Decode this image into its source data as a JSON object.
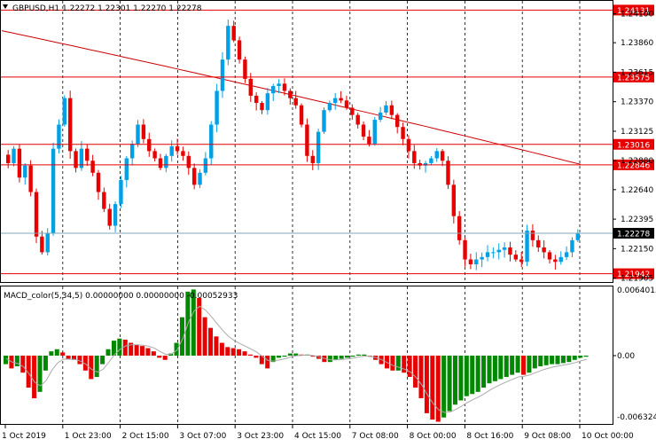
{
  "symbol_header": "GBPUSD,H1  1.22272 1.22301 1.22270 1.22278",
  "macd_header": "MACD_color(5,34,5) 0.00000000 0.00000000 -0.00052933",
  "colors": {
    "bull_candle": "#00a0e6",
    "bear_candle": "#e60000",
    "moving_average": "#cc0000",
    "level_line": "#e60000",
    "current_price_line": "#7fa7b8",
    "grid": "#000000",
    "macd_up": "#008800",
    "macd_down": "#e60000",
    "signal_line": "#aaaaaa",
    "price_label_bg": "#e60000",
    "current_label_bg": "#000000"
  },
  "chart_data": [
    {
      "type": "candlestick",
      "title": "GBPUSD,H1",
      "ylim": [
        1.2188,
        1.242
      ],
      "y_ticks": [
        "1.24100",
        "1.23860",
        "1.23615",
        "1.23370",
        "1.23125",
        "1.22880",
        "1.22640",
        "1.22395",
        "1.22150",
        "1.21905"
      ],
      "x_tick_labels": [
        "1 Oct 2019",
        "1 Oct 23:00",
        "2 Oct 15:00",
        "3 Oct 07:00",
        "3 Oct 23:00",
        "4 Oct 15:00",
        "7 Oct 08:00",
        "8 Oct 00:00",
        "8 Oct 16:00",
        "9 Oct 08:00",
        "10 Oct 00:00"
      ],
      "horizontal_levels": [
        "1.24131",
        "1.23575",
        "1.23016",
        "1.22846",
        "1.21942"
      ],
      "current_price": "1.22278",
      "ohlc_path": [
        1.2293,
        1.2286,
        1.2298,
        1.2274,
        1.2284,
        1.2262,
        1.2225,
        1.2212,
        1.2228,
        1.2298,
        1.2318,
        1.234,
        1.2296,
        1.2282,
        1.2298,
        1.2288,
        1.2278,
        1.2262,
        1.2248,
        1.2234,
        1.2252,
        1.2272,
        1.229,
        1.2302,
        1.2318,
        1.2306,
        1.2296,
        1.229,
        1.2282,
        1.2292,
        1.23,
        1.2296,
        1.2292,
        1.2282,
        1.2268,
        1.2278,
        1.229,
        1.2318,
        1.2346,
        1.2372,
        1.24,
        1.2388,
        1.2372,
        1.2356,
        1.2342,
        1.2336,
        1.233,
        1.2344,
        1.235,
        1.2352,
        1.2346,
        1.234,
        1.2334,
        1.2318,
        1.2292,
        1.2286,
        1.2312,
        1.233,
        1.2336,
        1.234,
        1.2338,
        1.2332,
        1.2326,
        1.2318,
        1.2308,
        1.2302,
        1.2322,
        1.2328,
        1.2334,
        1.2326,
        1.2316,
        1.2306,
        1.2296,
        1.2286,
        1.2284,
        1.2286,
        1.229,
        1.2296,
        1.2288,
        1.2268,
        1.2242,
        1.2222,
        1.2206,
        1.2202,
        1.2206,
        1.2208,
        1.2212,
        1.2212,
        1.2214,
        1.2216,
        1.221,
        1.2206,
        1.2204,
        1.223,
        1.2222,
        1.2216,
        1.2212,
        1.2206,
        1.2204,
        1.2208,
        1.2212,
        1.2222,
        1.2228
      ]
    },
    {
      "type": "bar",
      "title": "MACD_color(5,34,5)",
      "ylim": [
        -0.006324,
        0.006401
      ],
      "y_tick_labels": [
        "0.0064015",
        "0.00",
        "-0.006324"
      ],
      "histogram_values": [
        -0.0008,
        -0.0012,
        -0.001,
        -0.0016,
        -0.003,
        -0.004,
        -0.0034,
        -0.0014,
        0.0004,
        0.0006,
        0.0003,
        -0.0003,
        -0.0004,
        -0.0008,
        -0.0014,
        -0.0022,
        -0.002,
        -0.0008,
        0.0006,
        0.0014,
        0.0016,
        0.0015,
        0.0012,
        0.001,
        0.0009,
        0.0007,
        0.0004,
        -0.0002,
        -0.0004,
        0.0002,
        0.0012,
        0.0036,
        0.006,
        0.0062,
        0.0054,
        0.0036,
        0.0026,
        0.0018,
        0.0012,
        0.0008,
        0.0007,
        0.0006,
        0.0004,
        0.0001,
        -0.0002,
        -0.0008,
        -0.0012,
        -0.0006,
        -0.0002,
        -0.0001,
        0.0002,
        0.0002,
        0.0001,
        0.0001,
        -0.0001,
        -0.0003,
        -0.0006,
        -0.0006,
        -0.0004,
        -0.0003,
        -0.0002,
        -0.0001,
        0.0001,
        0.0001,
        -0.0001,
        -0.0004,
        -0.0008,
        -0.0012,
        -0.0014,
        -0.0014,
        -0.0016,
        -0.002,
        -0.003,
        -0.004,
        -0.0054,
        -0.006,
        -0.0062,
        -0.0058,
        -0.0052,
        -0.0046,
        -0.0042,
        -0.0038,
        -0.0036,
        -0.0034,
        -0.003,
        -0.0026,
        -0.0024,
        -0.0022,
        -0.002,
        -0.0018,
        -0.0016,
        -0.0018,
        -0.0016,
        -0.0012,
        -0.001,
        -0.0009,
        -0.0008,
        -0.0008,
        -0.0007,
        -0.0006,
        -0.0004,
        -0.0002,
        -0.0001
      ]
    }
  ]
}
